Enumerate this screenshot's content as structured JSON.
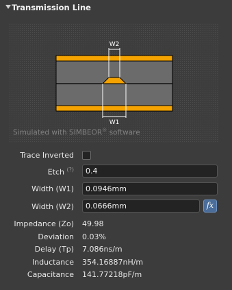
{
  "section": {
    "title": "Transmission Line"
  },
  "preview": {
    "simulated_text": "Simulated with SIMBEOR",
    "registered_mark": "®",
    "software_text": " software",
    "w1_label": "W1",
    "w2_label": "W2"
  },
  "fields": {
    "trace_inverted": {
      "label": "Trace Inverted",
      "checked": false
    },
    "etch": {
      "label": "Etch",
      "help": "(?)",
      "value": "0.4"
    },
    "width_w1": {
      "label": "Width (W1)",
      "value": "0.0946mm"
    },
    "width_w2": {
      "label": "Width (W2)",
      "value": "0.0666mm"
    },
    "fx_label": "fx"
  },
  "results": {
    "impedance": {
      "label": "Impedance (Zo)",
      "value": "49.98"
    },
    "deviation": {
      "label": "Deviation",
      "value": "0.03%"
    },
    "delay": {
      "label": "Delay (Tp)",
      "value": "7.086ns/m"
    },
    "inductance": {
      "label": "Inductance",
      "value": "354.16887nH/m"
    },
    "capacitance": {
      "label": "Capacitance",
      "value": "141.77218pF/m"
    }
  },
  "colors": {
    "copper": "#f5a300",
    "dielectric": "#6b6b6b",
    "background": "#3c3c3c",
    "accent": "#4a6d9a"
  }
}
